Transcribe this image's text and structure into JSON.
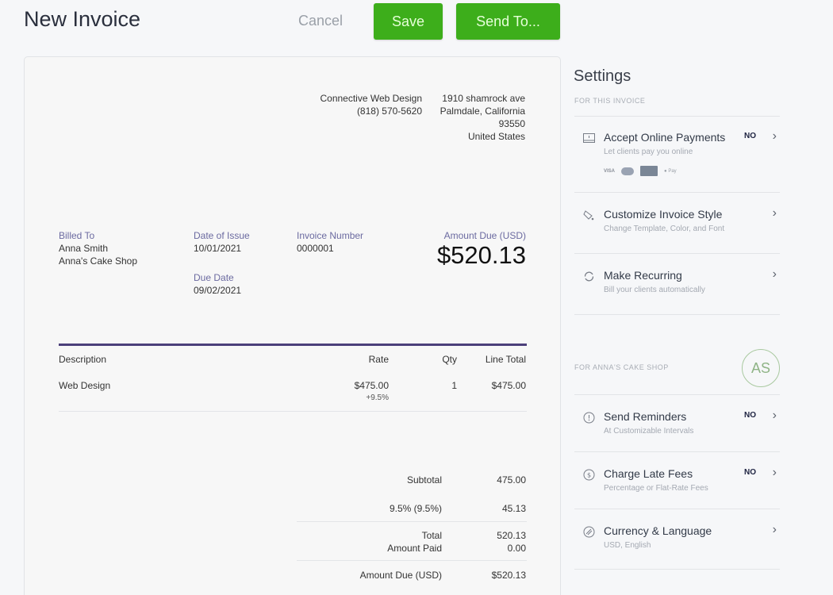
{
  "header": {
    "title": "New Invoice",
    "cancel_label": "Cancel",
    "save_label": "Save",
    "send_label": "Send To..."
  },
  "colors": {
    "primary_green": "#3dae1b",
    "accent_purple": "#4b3f7a",
    "label_purple": "#6b6aa0"
  },
  "invoice": {
    "business": {
      "name": "Connective Web Design",
      "phone": "(818) 570-5620",
      "address_line1": "1910 shamrock ave",
      "address_line2": "Palmdale, California",
      "zip": "93550",
      "country": "United States"
    },
    "billed_to": {
      "label": "Billed To",
      "name": "Anna Smith",
      "company": "Anna's Cake Shop"
    },
    "date_of_issue": {
      "label": "Date of Issue",
      "value": "10/01/2021"
    },
    "due_date": {
      "label": "Due Date",
      "value": "09/02/2021"
    },
    "invoice_number": {
      "label": "Invoice Number",
      "value": "0000001"
    },
    "amount_due": {
      "label": "Amount Due (USD)",
      "value": "$520.13"
    },
    "columns": {
      "description": "Description",
      "rate": "Rate",
      "qty": "Qty",
      "line_total": "Line Total"
    },
    "line_items": [
      {
        "description": "Web Design",
        "rate": "$475.00",
        "tax": "+9.5%",
        "qty": "1",
        "line_total": "$475.00"
      }
    ],
    "totals": {
      "subtotal_label": "Subtotal",
      "subtotal": "475.00",
      "tax_label": "9.5% (9.5%)",
      "tax": "45.13",
      "total_label": "Total",
      "total": "520.13",
      "paid_label": "Amount Paid",
      "paid": "0.00",
      "due_label": "Amount Due (USD)",
      "due": "$520.13"
    }
  },
  "settings": {
    "title": "Settings",
    "invoice_section_label": "FOR THIS INVOICE",
    "client_section_label": "FOR ANNA'S CAKE SHOP",
    "client_initials": "AS",
    "items": [
      {
        "name": "Accept Online Payments",
        "sub": "Let clients pay you online",
        "badge": "NO",
        "icon": "payment-terminal-icon"
      },
      {
        "name": "Customize Invoice Style",
        "sub": "Change Template, Color, and Font",
        "badge": "",
        "icon": "paint-bucket-icon"
      },
      {
        "name": "Make Recurring",
        "sub": "Bill your clients automatically",
        "badge": "",
        "icon": "refresh-icon"
      },
      {
        "name": "Send Reminders",
        "sub": "At Customizable Intervals",
        "badge": "NO",
        "icon": "alert-clock-icon"
      },
      {
        "name": "Charge Late Fees",
        "sub": "Percentage or Flat-Rate Fees",
        "badge": "NO",
        "icon": "dollar-coin-icon"
      },
      {
        "name": "Currency & Language",
        "sub": "USD, English",
        "badge": "",
        "icon": "globe-icon"
      }
    ],
    "payment_cards": [
      "VISA",
      "Mastercard",
      "Amex",
      "Pay"
    ]
  }
}
